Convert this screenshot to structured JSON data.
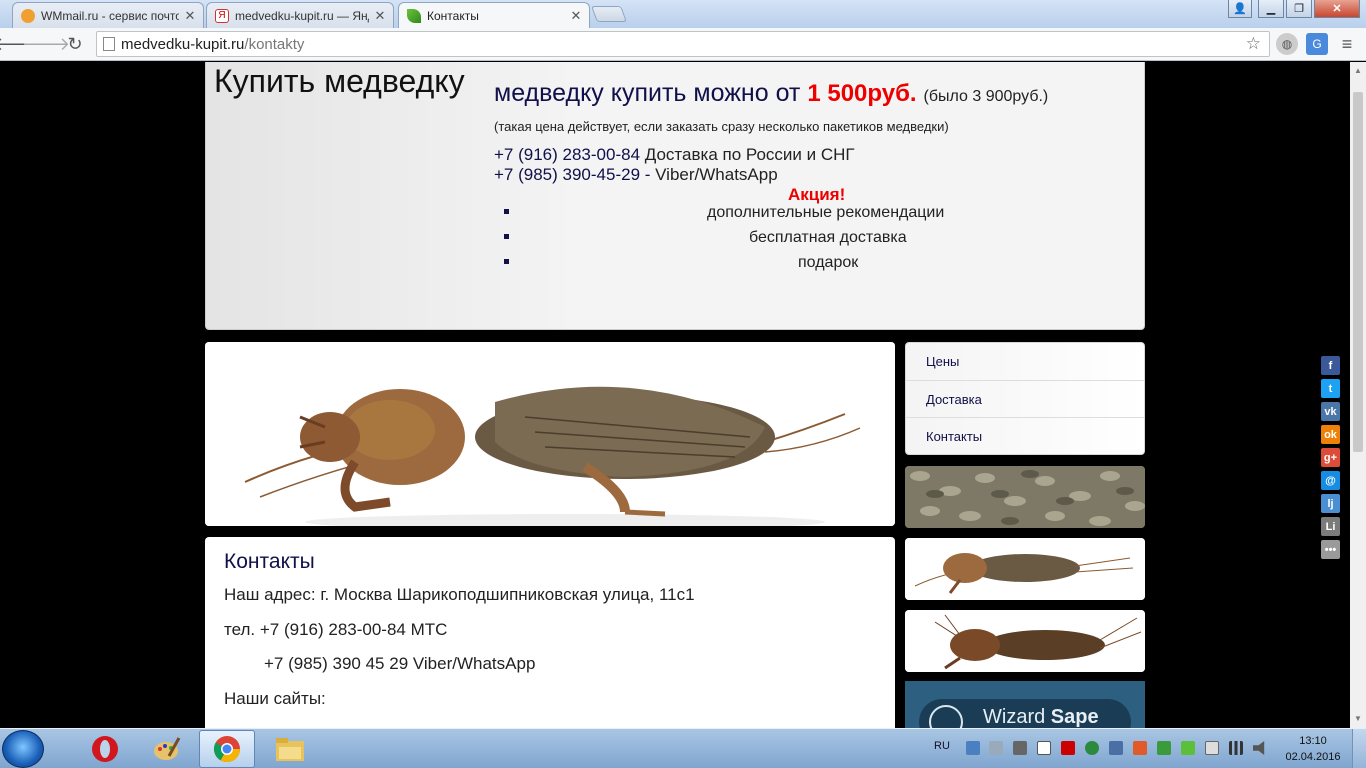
{
  "browser": {
    "tabs": [
      {
        "label": "WMmail.ru - сервис почто",
        "icon": "wmmail-icon"
      },
      {
        "label": "medvedku-kupit.ru — Янд",
        "icon": "yandex-icon"
      },
      {
        "label": "Контакты",
        "icon": "leaf-icon"
      }
    ],
    "url_host": "medvedku-kupit.ru",
    "url_path": "/kontakty"
  },
  "header": {
    "logo": "Купить медведку",
    "promo_text": "медведку купить можно от",
    "promo_price": "1 500руб.",
    "promo_old": "(было 3 900руб.)",
    "note": "(такая цена действует, если заказать сразу несколько пакетиков медведки)",
    "phone1": "+7 (916) 283-00-84",
    "phone1_label": "Доставка по России и СНГ",
    "phone2": "+7 (985) 390-45-29 -",
    "phone2_label": "Viber/WhatsApp",
    "akcia": "Акция!",
    "bullets": [
      "дополнительные рекомендации",
      "бесплатная доставка",
      "подарок"
    ]
  },
  "menu": [
    "Цены",
    "Доставка",
    "Контакты"
  ],
  "content": {
    "title": "Контакты",
    "address": "Наш адрес:  г. Москва Шарикоподшипниковская улица, 11с1",
    "tel1": "тел. +7 (916) 283-00-84 МТС",
    "tel2": "+7 (985) 390 45 29 Viber/WhatsApp",
    "sites": "Наши сайты:"
  },
  "ad": {
    "brand": "Wizard",
    "brand_bold": "Sape"
  },
  "social": [
    {
      "name": "facebook-icon",
      "glyph": "f",
      "color": "#3b5998"
    },
    {
      "name": "twitter-icon",
      "glyph": "t",
      "color": "#1da1f2"
    },
    {
      "name": "vk-icon",
      "glyph": "vk",
      "color": "#4a76a8"
    },
    {
      "name": "odnoklassniki-icon",
      "glyph": "ok",
      "color": "#ee8208"
    },
    {
      "name": "google-plus-icon",
      "glyph": "g+",
      "color": "#dd4b39"
    },
    {
      "name": "mail-icon",
      "glyph": "@",
      "color": "#168de2"
    },
    {
      "name": "livejournal-icon",
      "glyph": "lj",
      "color": "#4b8ed1"
    },
    {
      "name": "liveinternet-icon",
      "glyph": "Li",
      "color": "#7b7b7b"
    },
    {
      "name": "more-icon",
      "glyph": "•••",
      "color": "#9a9a9a"
    }
  ],
  "taskbar": {
    "lang": "RU",
    "time": "13:10",
    "date": "02.04.2016"
  }
}
